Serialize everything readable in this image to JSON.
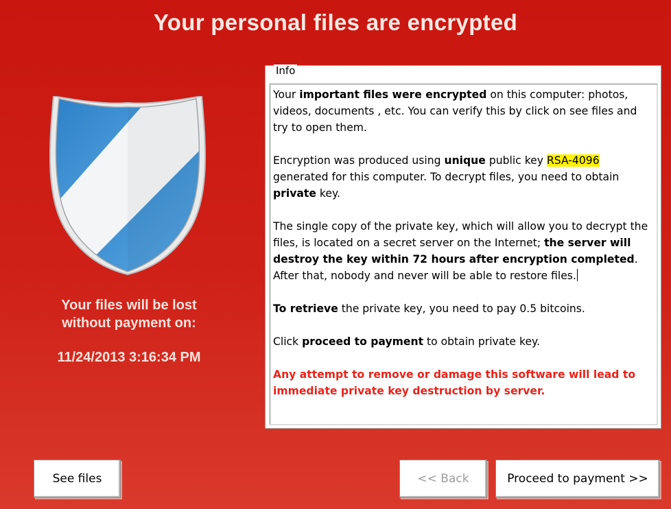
{
  "window": {
    "title": "Your personal files are encrypted"
  },
  "left_panel": {
    "lost_line1": "Your files will be lost",
    "lost_line2": "without payment on:",
    "deadline": "11/24/2013 3:16:34 PM",
    "shield_icon": "shield-icon"
  },
  "info": {
    "legend": "Info",
    "p1": {
      "t1": "Your ",
      "b1": "important files were encrypted",
      "t2": " on this computer: photos, videos, documents , etc. You can verify this by click on see files and try to open them."
    },
    "p2": {
      "t1": "Encryption was produced using ",
      "b1": "unique",
      "t2": " public key ",
      "hl": "RSA-4096",
      "t3": " generated for this computer. To decrypt files, you need to obtain ",
      "b2": "private",
      "t4": " key."
    },
    "p3": {
      "t1": "The single copy of the private key, which will allow you to decrypt the files, is located on a secret server on the Internet; ",
      "b1": "the server will destroy the key within 72 hours after encryption completed",
      "t2": ". After that, nobody and never will be able to restore files."
    },
    "p4": {
      "b1": "To retrieve",
      "t1": " the private key, you need to pay 0.5 bitcoins."
    },
    "p5": {
      "t1": "Click ",
      "b1": "proceed to payment",
      "t2": " to obtain private key."
    },
    "p6": {
      "warn": "Any attempt to remove or damage this software will lead to immediate private key destruction by server."
    }
  },
  "buttons": {
    "see_files": "See files",
    "back": "<< Back",
    "proceed": "Proceed to payment >>"
  },
  "colors": {
    "background": "#cf2118",
    "highlight": "#fff200",
    "warning_text": "#e8231a",
    "shield_blue": "#2f86cc"
  }
}
